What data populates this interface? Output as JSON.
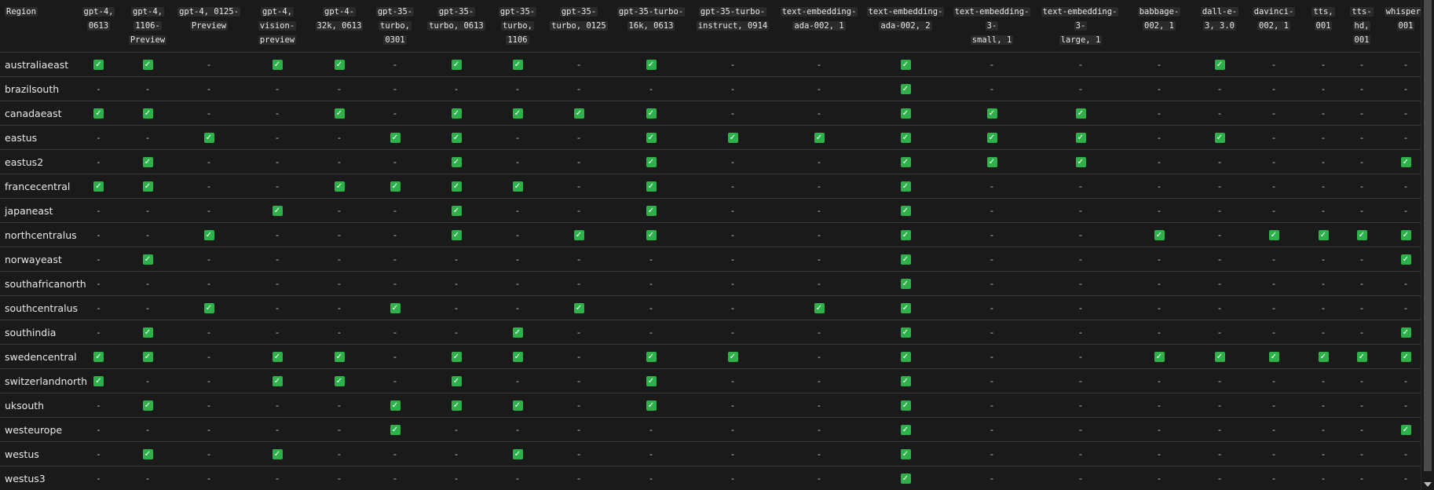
{
  "columns": [
    [
      "gpt-4,",
      "0613"
    ],
    [
      "gpt-4, 1106-",
      "Preview"
    ],
    [
      "gpt-4, 0125-",
      "Preview"
    ],
    [
      "gpt-4,",
      "vision-",
      "preview"
    ],
    [
      "gpt-4-",
      "32k, 0613"
    ],
    [
      "gpt-35-",
      "turbo, 0301"
    ],
    [
      "gpt-35-",
      "turbo, 0613"
    ],
    [
      "gpt-35-",
      "turbo, 1106"
    ],
    [
      "gpt-35-",
      "turbo, 0125"
    ],
    [
      "gpt-35-turbo-",
      "16k, 0613"
    ],
    [
      "gpt-35-turbo-",
      "instruct, 0914"
    ],
    [
      "text-embedding-",
      "ada-002, 1"
    ],
    [
      "text-embedding-",
      "ada-002, 2"
    ],
    [
      "text-embedding-3-",
      "small, 1"
    ],
    [
      "text-embedding-3-",
      "large, 1"
    ],
    [
      "babbage-",
      "002, 1"
    ],
    [
      "dall-e-",
      "3, 3.0"
    ],
    [
      "davinci-",
      "002, 1"
    ],
    [
      "tts,",
      "001"
    ],
    [
      "tts-hd,",
      "001"
    ],
    [
      "whisper,",
      "001"
    ]
  ],
  "header": {
    "region_label": "Region"
  },
  "symbols": {
    "check": "✓",
    "dash": "-"
  },
  "rows": [
    {
      "region": "australiaeast",
      "avail": [
        1,
        1,
        0,
        1,
        1,
        0,
        1,
        1,
        0,
        1,
        0,
        0,
        1,
        0,
        0,
        0,
        1,
        0,
        0,
        0,
        0
      ]
    },
    {
      "region": "brazilsouth",
      "avail": [
        0,
        0,
        0,
        0,
        0,
        0,
        0,
        0,
        0,
        0,
        0,
        0,
        1,
        0,
        0,
        0,
        0,
        0,
        0,
        0,
        0
      ]
    },
    {
      "region": "canadaeast",
      "avail": [
        1,
        1,
        0,
        0,
        1,
        0,
        1,
        1,
        1,
        1,
        0,
        0,
        1,
        1,
        1,
        0,
        0,
        0,
        0,
        0,
        0
      ]
    },
    {
      "region": "eastus",
      "avail": [
        0,
        0,
        1,
        0,
        0,
        1,
        1,
        0,
        0,
        1,
        1,
        1,
        1,
        1,
        1,
        0,
        1,
        0,
        0,
        0,
        0
      ]
    },
    {
      "region": "eastus2",
      "avail": [
        0,
        1,
        0,
        0,
        0,
        0,
        1,
        0,
        0,
        1,
        0,
        0,
        1,
        1,
        1,
        0,
        0,
        0,
        0,
        0,
        1
      ]
    },
    {
      "region": "francecentral",
      "avail": [
        1,
        1,
        0,
        0,
        1,
        1,
        1,
        1,
        0,
        1,
        0,
        0,
        1,
        0,
        0,
        0,
        0,
        0,
        0,
        0,
        0
      ]
    },
    {
      "region": "japaneast",
      "avail": [
        0,
        0,
        0,
        1,
        0,
        0,
        1,
        0,
        0,
        1,
        0,
        0,
        1,
        0,
        0,
        0,
        0,
        0,
        0,
        0,
        0
      ]
    },
    {
      "region": "northcentralus",
      "avail": [
        0,
        0,
        1,
        0,
        0,
        0,
        1,
        0,
        1,
        1,
        0,
        0,
        1,
        0,
        0,
        1,
        0,
        1,
        1,
        1,
        1
      ]
    },
    {
      "region": "norwayeast",
      "avail": [
        0,
        1,
        0,
        0,
        0,
        0,
        0,
        0,
        0,
        0,
        0,
        0,
        1,
        0,
        0,
        0,
        0,
        0,
        0,
        0,
        1
      ]
    },
    {
      "region": "southafricanorth",
      "avail": [
        0,
        0,
        0,
        0,
        0,
        0,
        0,
        0,
        0,
        0,
        0,
        0,
        1,
        0,
        0,
        0,
        0,
        0,
        0,
        0,
        0
      ]
    },
    {
      "region": "southcentralus",
      "avail": [
        0,
        0,
        1,
        0,
        0,
        1,
        0,
        0,
        1,
        0,
        0,
        1,
        1,
        0,
        0,
        0,
        0,
        0,
        0,
        0,
        0
      ]
    },
    {
      "region": "southindia",
      "avail": [
        0,
        1,
        0,
        0,
        0,
        0,
        0,
        1,
        0,
        0,
        0,
        0,
        1,
        0,
        0,
        0,
        0,
        0,
        0,
        0,
        1
      ]
    },
    {
      "region": "swedencentral",
      "avail": [
        1,
        1,
        0,
        1,
        1,
        0,
        1,
        1,
        0,
        1,
        1,
        0,
        1,
        0,
        0,
        1,
        1,
        1,
        1,
        1,
        1
      ]
    },
    {
      "region": "switzerlandnorth",
      "avail": [
        1,
        0,
        0,
        1,
        1,
        0,
        1,
        0,
        0,
        1,
        0,
        0,
        1,
        0,
        0,
        0,
        0,
        0,
        0,
        0,
        0
      ]
    },
    {
      "region": "uksouth",
      "avail": [
        0,
        1,
        0,
        0,
        0,
        1,
        1,
        1,
        0,
        1,
        0,
        0,
        1,
        0,
        0,
        0,
        0,
        0,
        0,
        0,
        0
      ]
    },
    {
      "region": "westeurope",
      "avail": [
        0,
        0,
        0,
        0,
        0,
        1,
        0,
        0,
        0,
        0,
        0,
        0,
        1,
        0,
        0,
        0,
        0,
        0,
        0,
        0,
        1
      ]
    },
    {
      "region": "westus",
      "avail": [
        0,
        1,
        0,
        1,
        0,
        0,
        0,
        1,
        0,
        0,
        0,
        0,
        1,
        0,
        0,
        0,
        0,
        0,
        0,
        0,
        0
      ]
    },
    {
      "region": "westus3",
      "avail": [
        0,
        0,
        0,
        0,
        0,
        0,
        0,
        0,
        0,
        0,
        0,
        0,
        1,
        0,
        0,
        0,
        0,
        0,
        0,
        0,
        0
      ]
    }
  ]
}
